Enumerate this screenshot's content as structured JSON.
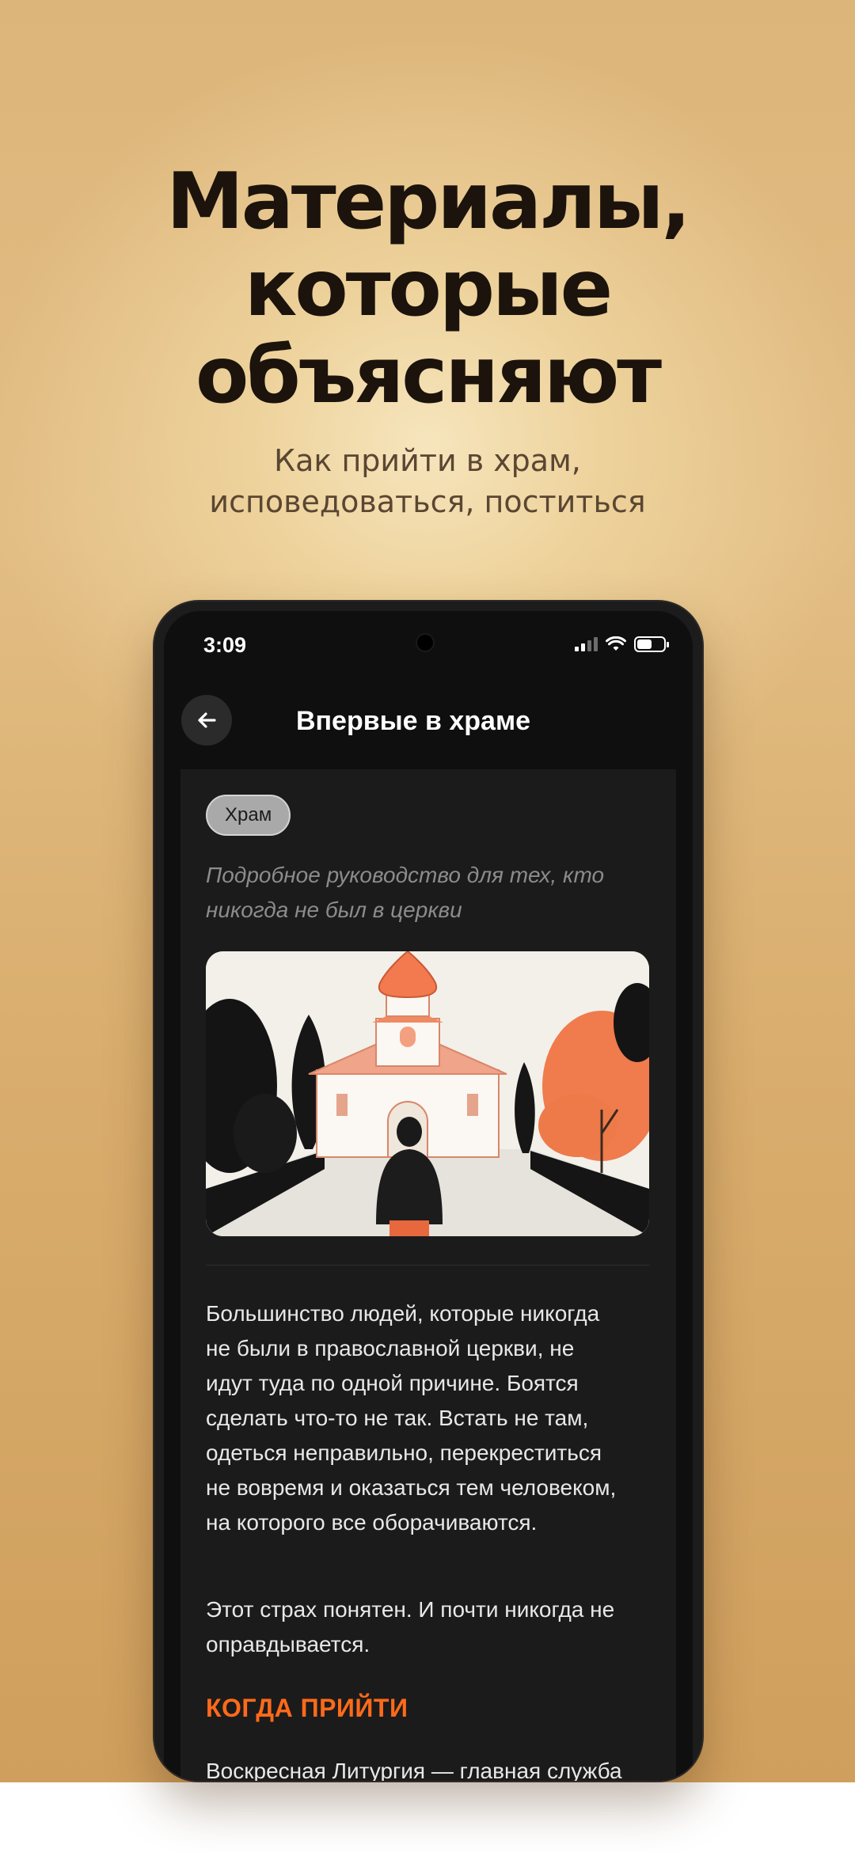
{
  "promo": {
    "headline_lines": [
      "Материалы,",
      "которые",
      "объясняют"
    ],
    "subhead_lines": [
      "Как прийти в храм,",
      "исповедоваться, поститься"
    ]
  },
  "status_bar": {
    "time": "3:09",
    "icons": [
      "signal-icon",
      "wifi-icon",
      "battery-icon"
    ]
  },
  "header": {
    "back_icon": "arrow-left-icon",
    "title": "Впервые в храме"
  },
  "article": {
    "tag": "Храм",
    "lead_lines": [
      "Подробное руководство для тех, кто",
      "никогда не был в церкви"
    ],
    "illustration": "church-illustration",
    "paragraph_1_lines": [
      "Большинство людей, которые никогда",
      "не были в православной церкви, не",
      "идут туда по одной причине. Боятся",
      "сделать что-то не так. Встать не там,",
      "одеться неправильно, перекреститься",
      "не вовремя и оказаться тем человеком,",
      "на которого все оборачиваются."
    ],
    "paragraph_2_lines": [
      "Этот страх понятен. И почти никогда не",
      "оправдывается."
    ],
    "section_heading": "КОГДА ПРИЙТИ",
    "paragraph_3_lines": [
      "Воскресная Литургия — главная служба"
    ]
  },
  "colors": {
    "accent": "#ff6a1a",
    "screen_bg": "#0f0f0f",
    "card_bg": "#1b1b1b",
    "promo_bg": "#e2bd84"
  }
}
